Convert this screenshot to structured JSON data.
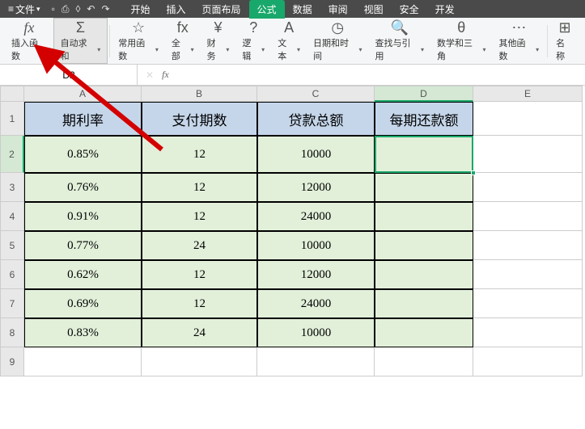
{
  "menubar": {
    "file": "文件",
    "tabs": [
      "开始",
      "插入",
      "页面布局",
      "公式",
      "数据",
      "审阅",
      "视图",
      "安全",
      "开发"
    ],
    "active_tab_index": 3
  },
  "ribbon": {
    "insert_fn": "插入函数",
    "insert_fn_icon": "fx",
    "autosum": "自动求和",
    "autosum_icon": "Σ",
    "recent": "常用函数",
    "all": "全部",
    "financial": "财务",
    "logical": "逻辑",
    "text": "文本",
    "datetime": "日期和时间",
    "lookup": "查找与引用",
    "math": "数学和三角",
    "other": "其他函数",
    "name_mgr": "名称"
  },
  "formulabar": {
    "namebox": "D2",
    "fx": "fx",
    "value": ""
  },
  "grid": {
    "cols": [
      "A",
      "B",
      "C",
      "D",
      "E"
    ],
    "selected_col": "D",
    "selected_row": "2",
    "headers": [
      "期利率",
      "支付期数",
      "贷款总额",
      "每期还款额"
    ],
    "rows": [
      {
        "rate": "0.85%",
        "periods": "12",
        "total": "10000",
        "payment": ""
      },
      {
        "rate": "0.76%",
        "periods": "12",
        "total": "12000",
        "payment": ""
      },
      {
        "rate": "0.91%",
        "periods": "12",
        "total": "24000",
        "payment": ""
      },
      {
        "rate": "0.77%",
        "periods": "24",
        "total": "10000",
        "payment": ""
      },
      {
        "rate": "0.62%",
        "periods": "12",
        "total": "12000",
        "payment": ""
      },
      {
        "rate": "0.69%",
        "periods": "12",
        "total": "24000",
        "payment": ""
      },
      {
        "rate": "0.83%",
        "periods": "24",
        "total": "10000",
        "payment": ""
      }
    ],
    "row_numbers": [
      "1",
      "2",
      "3",
      "4",
      "5",
      "6",
      "7",
      "8",
      "9"
    ]
  }
}
